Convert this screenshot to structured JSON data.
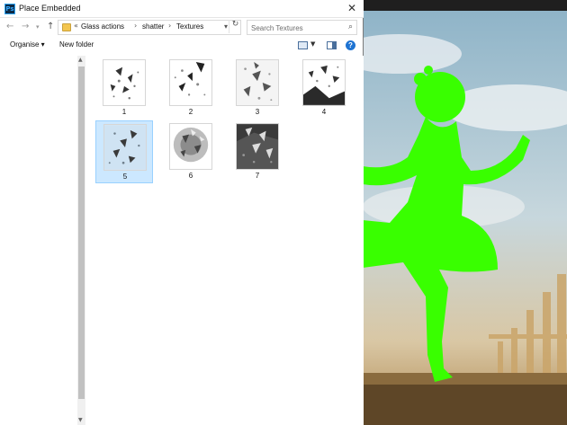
{
  "window": {
    "title": "Place Embedded",
    "close_glyph": "✕"
  },
  "address": {
    "overflow": "«",
    "breadcrumb": [
      "Glass actions",
      "shatter",
      "Textures"
    ],
    "search_placeholder": "Search Textures"
  },
  "toolbar": {
    "organise_label": "Organise ▾",
    "new_folder_label": "New folder",
    "help_glyph": "?"
  },
  "files": [
    {
      "label": "1",
      "selected": false
    },
    {
      "label": "2",
      "selected": false
    },
    {
      "label": "3",
      "selected": false
    },
    {
      "label": "4",
      "selected": false
    },
    {
      "label": "5",
      "selected": true
    },
    {
      "label": "6",
      "selected": false
    },
    {
      "label": "7",
      "selected": false
    }
  ],
  "colors": {
    "selection": "#cce8ff",
    "accent": "#1e73d2",
    "subject": "#39ff00"
  }
}
